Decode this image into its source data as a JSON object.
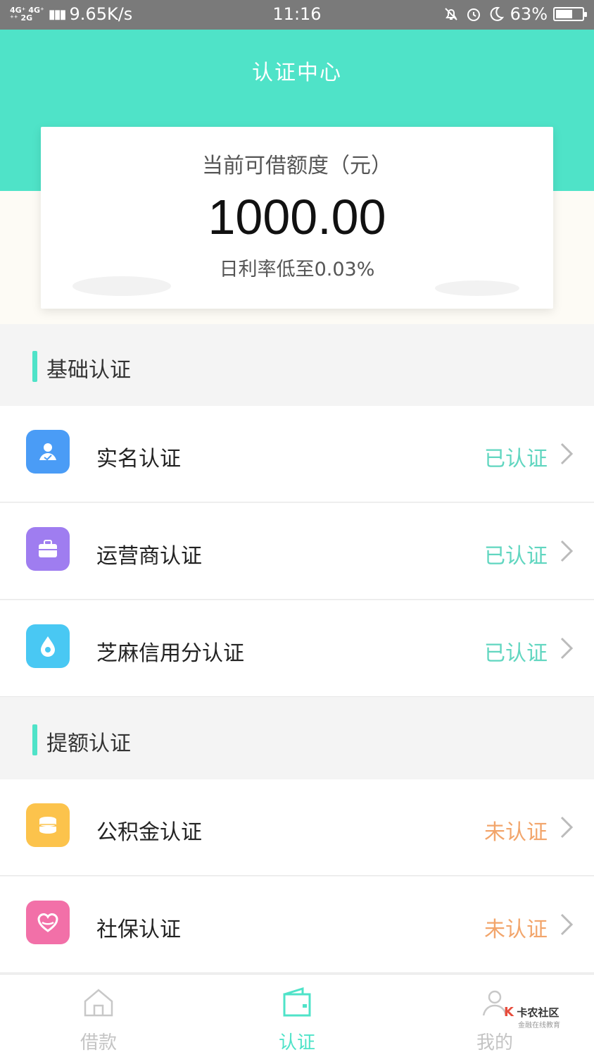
{
  "status_bar": {
    "network_top": "4G⁺ 4G⁺",
    "network_bottom": "⁺⁺ 2G",
    "speed": "9.65K/s",
    "time": "11:16",
    "battery": "63%",
    "battery_level": 0.63
  },
  "header": {
    "title": "认证中心"
  },
  "credit_card": {
    "label": "当前可借额度（元）",
    "amount": "1000.00",
    "rate": "日利率低至0.03%"
  },
  "sections": {
    "basic": {
      "title": "基础认证",
      "items": [
        {
          "name": "实名认证",
          "status": "已认证",
          "icon": "id-card-icon",
          "color": "#4a9cf6"
        },
        {
          "name": "运营商认证",
          "status": "已认证",
          "icon": "briefcase-icon",
          "color": "#9f7df0"
        },
        {
          "name": "芝麻信用分认证",
          "status": "已认证",
          "icon": "sesame-drop-icon",
          "color": "#49c8f3"
        }
      ]
    },
    "advanced": {
      "title": "提额认证",
      "items": [
        {
          "name": "公积金认证",
          "status": "未认证",
          "icon": "coins-icon",
          "color": "#fcc34c"
        },
        {
          "name": "社保认证",
          "status": "未认证",
          "icon": "heart-hands-icon",
          "color": "#f270a8"
        }
      ]
    }
  },
  "colors": {
    "accent": "#4fe3c8",
    "verified": "#61d6c0",
    "unverified": "#f2a56b"
  },
  "tabbar": {
    "tabs": [
      {
        "label": "借款",
        "icon": "home-icon",
        "active": false
      },
      {
        "label": "认证",
        "icon": "wallet-icon",
        "active": true
      },
      {
        "label": "我的",
        "icon": "user-icon",
        "active": false
      }
    ]
  },
  "watermark": {
    "title": "卡农社区",
    "subtitle": "金融在线教育"
  }
}
